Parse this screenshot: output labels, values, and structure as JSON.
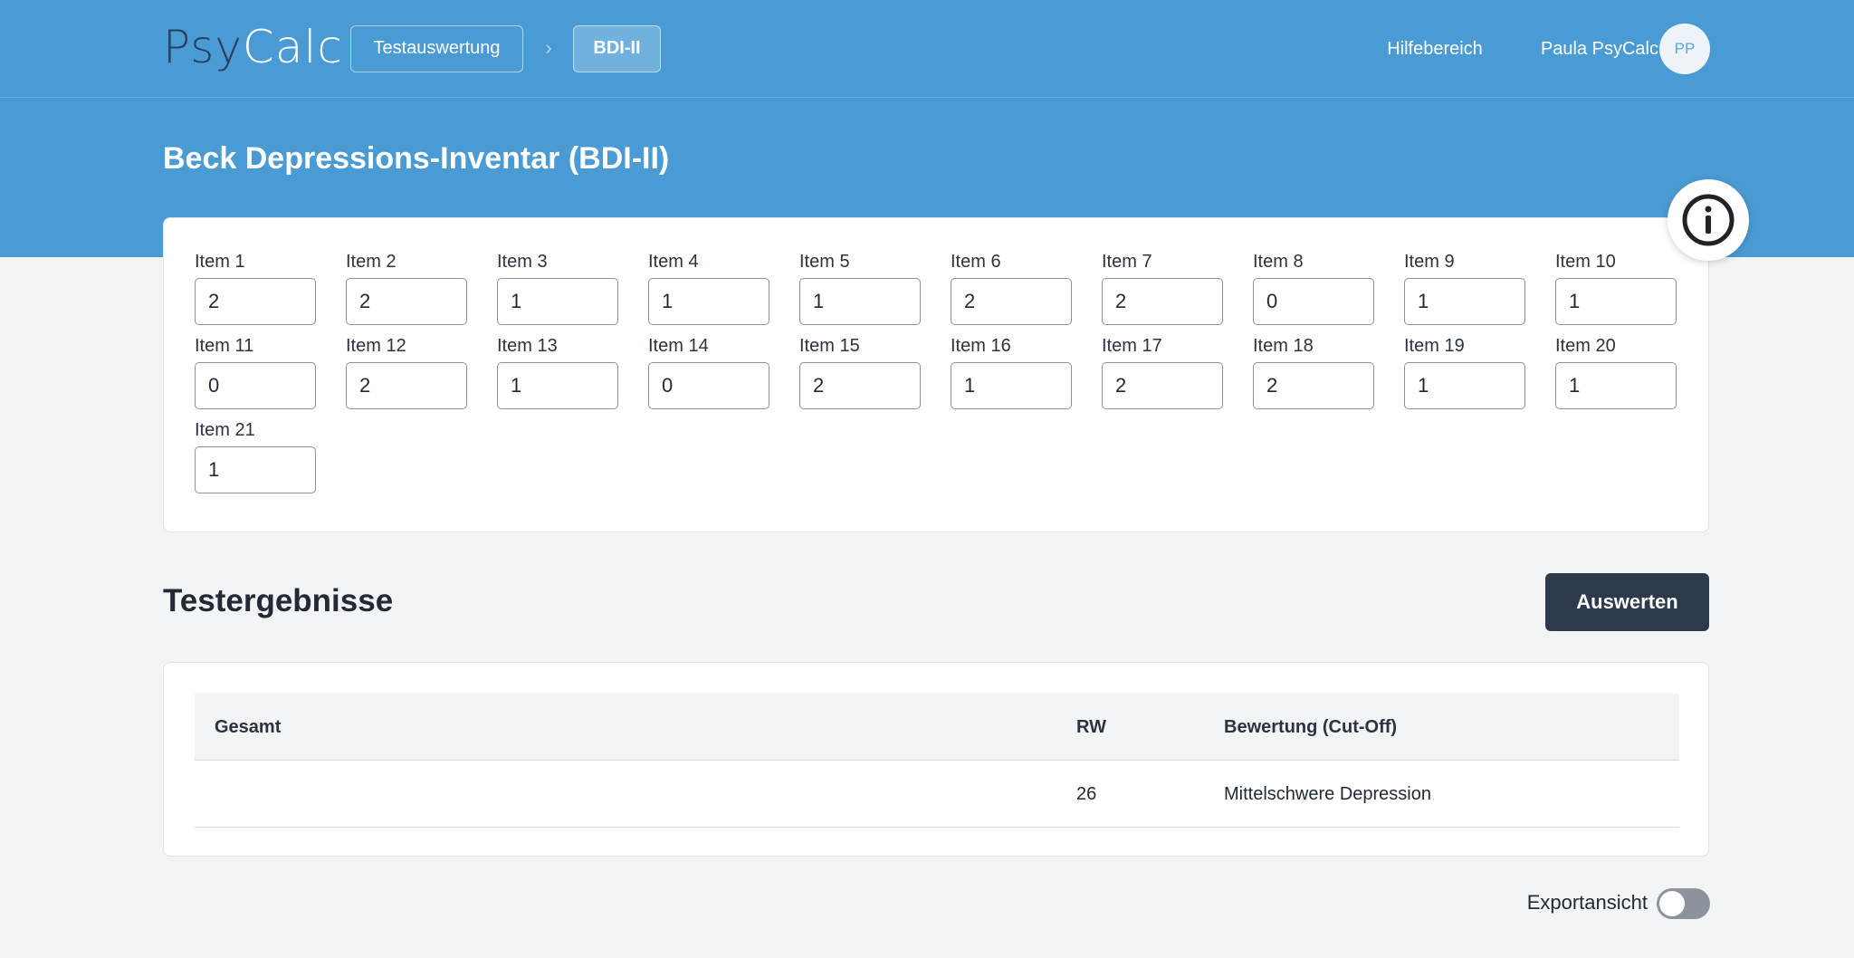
{
  "header": {
    "logo_part1": "Psy",
    "logo_part2": "Calc",
    "breadcrumb": [
      "Testauswertung",
      "BDI-II"
    ],
    "help_link": "Hilfebereich",
    "user_name": "Paula PsyCalc",
    "avatar_initials": "PP"
  },
  "page": {
    "title": "Beck Depressions-Inventar (BDI-II)"
  },
  "items": [
    {
      "label": "Item 1",
      "value": "2"
    },
    {
      "label": "Item 2",
      "value": "2"
    },
    {
      "label": "Item 3",
      "value": "1"
    },
    {
      "label": "Item 4",
      "value": "1"
    },
    {
      "label": "Item 5",
      "value": "1"
    },
    {
      "label": "Item 6",
      "value": "2"
    },
    {
      "label": "Item 7",
      "value": "2"
    },
    {
      "label": "Item 8",
      "value": "0"
    },
    {
      "label": "Item 9",
      "value": "1"
    },
    {
      "label": "Item 10",
      "value": "1"
    },
    {
      "label": "Item 11",
      "value": "0"
    },
    {
      "label": "Item 12",
      "value": "2"
    },
    {
      "label": "Item 13",
      "value": "1"
    },
    {
      "label": "Item 14",
      "value": "0"
    },
    {
      "label": "Item 15",
      "value": "2"
    },
    {
      "label": "Item 16",
      "value": "1"
    },
    {
      "label": "Item 17",
      "value": "2"
    },
    {
      "label": "Item 18",
      "value": "2"
    },
    {
      "label": "Item 19",
      "value": "1"
    },
    {
      "label": "Item 20",
      "value": "1"
    },
    {
      "label": "Item 21",
      "value": "1"
    }
  ],
  "results": {
    "title": "Testergebnisse",
    "evaluate_button": "Auswerten",
    "columns": [
      "Gesamt",
      "RW",
      "Bewertung (Cut-Off)"
    ],
    "rows": [
      {
        "label": "",
        "rw": "26",
        "rating": "Mittelschwere Depression"
      }
    ]
  },
  "export_toggle": {
    "label": "Exportansicht",
    "enabled": false
  },
  "colors": {
    "header_bg": "#4a9bd4",
    "logo_dark": "#2a3f5e",
    "button_dark": "#2d3a4b",
    "page_bg": "#f2f4f6"
  }
}
